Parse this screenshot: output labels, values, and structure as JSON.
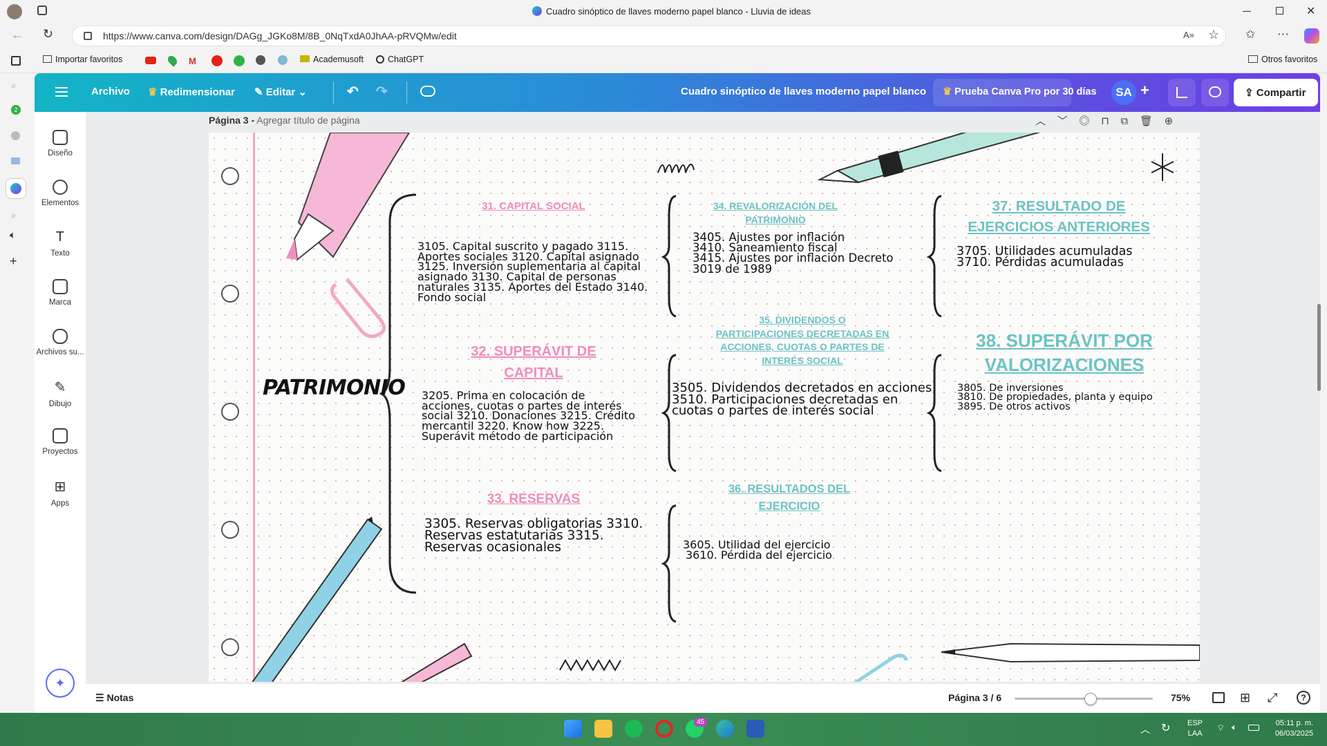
{
  "browser": {
    "window_title": "Cuadro sinóptico de llaves moderno papel blanco - Lluvia de ideas",
    "url": "https://www.canva.com/design/DAGg_JGKo8M/8B_0NqTxdA0JhAA-pRVQMw/edit",
    "bookmarks": [
      "Importar favoritos",
      "Academusoft",
      "ChatGPT"
    ],
    "other_favorites": "Otros favoritos"
  },
  "canva_header": {
    "file": "Archivo",
    "resize": "Redimensionar",
    "edit": "Editar",
    "design_title": "Cuadro sinóptico de llaves moderno papel blanco",
    "pro_trial": "Prueba Canva Pro por 30 días",
    "avatar": "SA",
    "share": "Compartir"
  },
  "left_panel": [
    {
      "label": "Diseño",
      "icon": "layout-icon"
    },
    {
      "label": "Elementos",
      "icon": "elements-icon"
    },
    {
      "label": "Texto",
      "icon": "text-icon"
    },
    {
      "label": "Marca",
      "icon": "brand-icon"
    },
    {
      "label": "Archivos su...",
      "icon": "upload-icon"
    },
    {
      "label": "Dibujo",
      "icon": "draw-icon"
    },
    {
      "label": "Proyectos",
      "icon": "folder-icon"
    },
    {
      "label": "Apps",
      "icon": "apps-icon"
    }
  ],
  "page_header": {
    "page_label": "Página 3 -",
    "add_title": "Agregar título de página"
  },
  "design": {
    "main_title": "PATRIMONIO",
    "sections": {
      "s31": {
        "title": "31. CAPITAL SOCIAL",
        "body": [
          "3105. Capital suscrito y pagado 3115.",
          "Aportes sociales 3120. Capital asignado",
          "3125. Inversión suplementaria al capital",
          "asignado 3130. Capital de personas",
          "naturales 3135. Aportes del Estado 3140.",
          "Fondo social"
        ]
      },
      "s32": {
        "title": [
          "32. SUPERÁVIT DE",
          "CAPITAL"
        ],
        "body": [
          "3205. Prima en colocación de",
          "acciones, cuotas o partes de interés",
          "social 3210. Donaciones 3215. Crédito",
          "mercantil 3220. Know how 3225.",
          "Superávit método de participación"
        ]
      },
      "s33": {
        "title": "33. RESERVAS",
        "body": [
          "3305. Reservas obligatorias 3310.",
          "Reservas estatutarias 3315.",
          "Reservas ocasionales"
        ]
      },
      "s34": {
        "title": [
          "34. REVALORIZACIÓN DEL",
          "PATRIMONIO"
        ],
        "body": [
          "3405. Ajustes por inflación",
          "3410. Saneamiento fiscal",
          "3415. Ajustes por inflación Decreto",
          "3019 de 1989"
        ]
      },
      "s35": {
        "title": [
          "35. DIVIDENDOS O",
          "PARTICIPACIONES DECRETADAS EN",
          "ACCIONES, CUOTAS O PARTES DE",
          "INTERÉS SOCIAL"
        ],
        "body": [
          "3505. Dividendos decretados en acciones",
          "3510. Participaciones decretadas en",
          "cuotas o partes de interés social"
        ]
      },
      "s36": {
        "title": [
          "36. RESULTADOS DEL",
          "EJERCICIO"
        ],
        "body": [
          "3605. Utilidad del ejercicio",
          "3610. Pérdida del ejercicio"
        ]
      },
      "s37": {
        "title": [
          "37. RESULTADO DE",
          "EJERCICIOS ANTERIORES"
        ],
        "body": [
          "3705. Utilidades acumuladas",
          "3710. Pérdidas acumuladas"
        ]
      },
      "s38": {
        "title": [
          "38. SUPERÁVIT POR",
          "VALORIZACIONES"
        ],
        "body": [
          "3805. De inversiones",
          "3810. De propiedades, planta y equipo",
          "3895. De otros activos"
        ]
      }
    },
    "colors": {
      "pink": "#f08dbb",
      "teal": "#6cc3c3"
    }
  },
  "bottom_bar": {
    "notes": "Notas",
    "page_indicator": "Página 3 / 6",
    "zoom": "75%",
    "zoom_level": 0.55
  },
  "taskbar": {
    "whatsapp_badge": "45",
    "lang": "ESP",
    "lang2": "LAA",
    "time": "05:11 p. m.",
    "date": "06/03/2025"
  }
}
